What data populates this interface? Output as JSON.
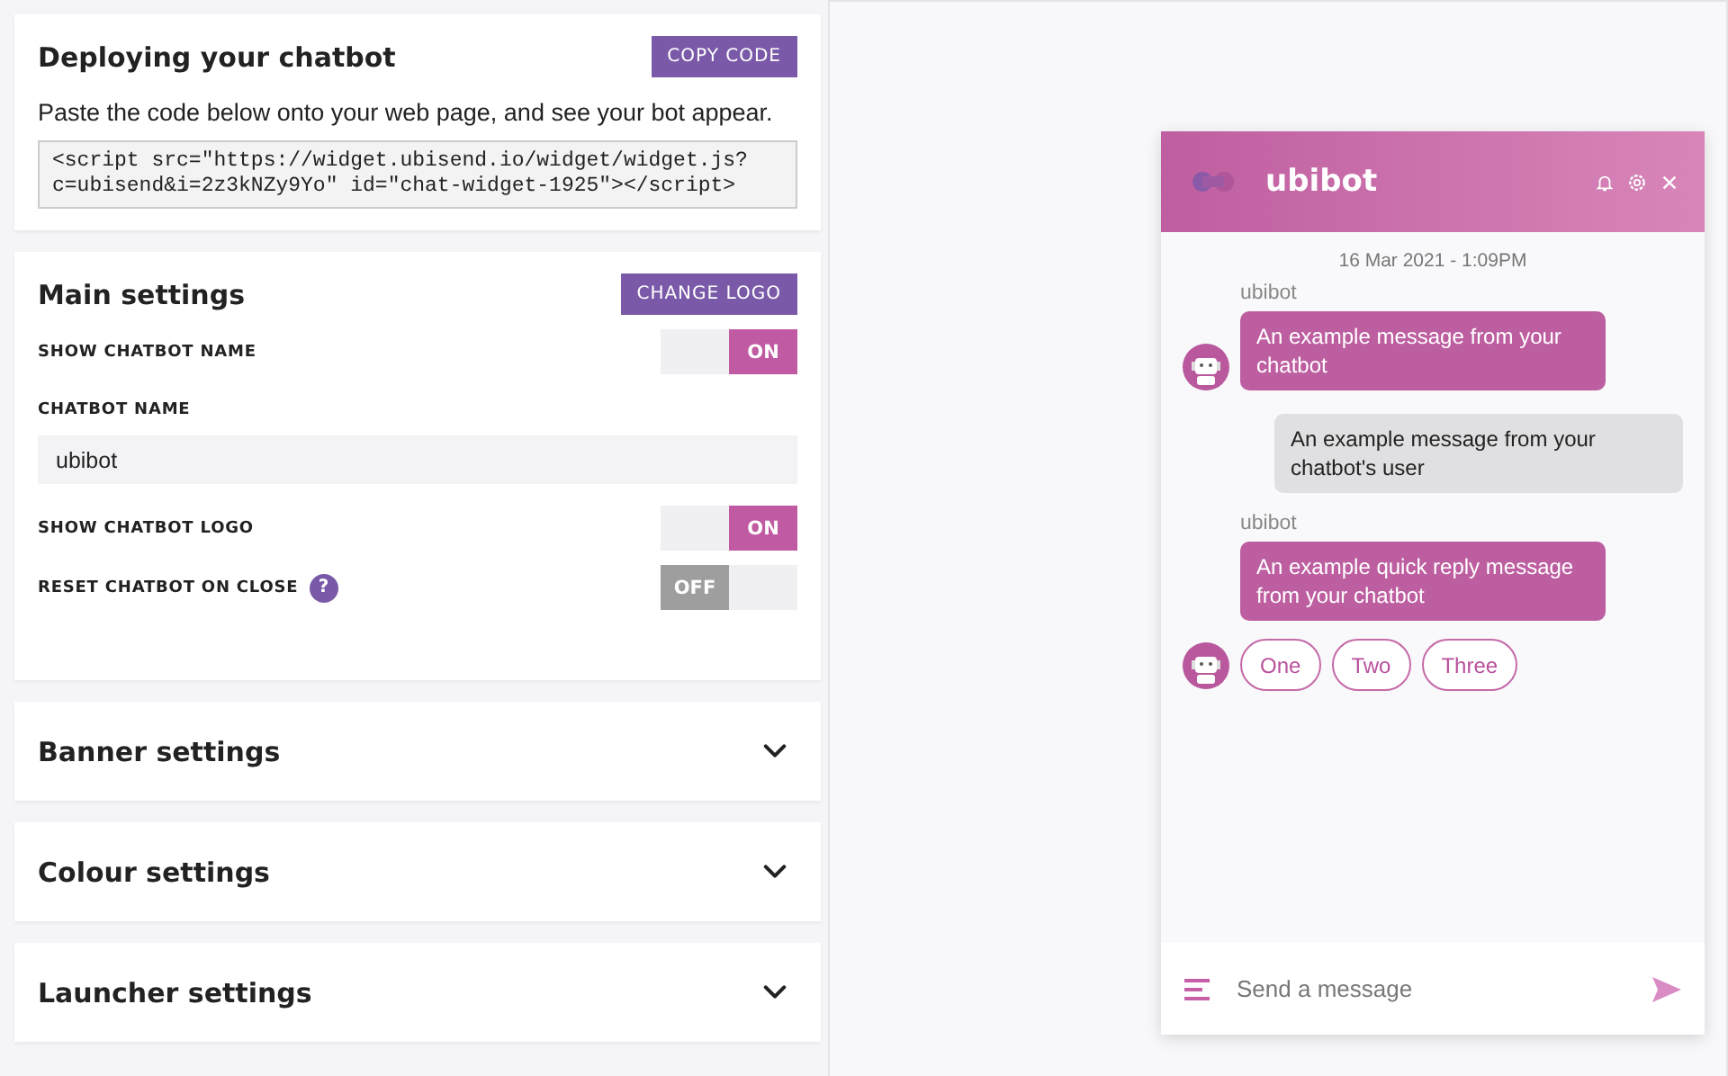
{
  "deploy": {
    "title": "Deploying your chatbot",
    "button": "COPY CODE",
    "description": "Paste the code below onto your web page, and see your bot appear.",
    "code": "<script src=\"https://widget.ubisend.io/widget/widget.js?\nc=ubisend&i=2z3kNZy9Yo\" id=\"chat-widget-1925\"></script>"
  },
  "main_settings": {
    "title": "Main settings",
    "button": "CHANGE LOGO",
    "rows": [
      {
        "kind": "toggle",
        "label": "SHOW CHATBOT NAME",
        "on": true,
        "state_label": "ON"
      },
      {
        "kind": "field",
        "label": "CHATBOT NAME",
        "value": "ubibot"
      },
      {
        "kind": "toggle",
        "label": "SHOW CHATBOT LOGO",
        "on": true,
        "state_label": "ON"
      },
      {
        "kind": "toggle",
        "label": "RESET CHATBOT ON CLOSE",
        "help": "?",
        "on": false,
        "state_label": "OFF"
      }
    ]
  },
  "sections": [
    {
      "title": "Banner settings",
      "expanded": false
    },
    {
      "title": "Colour settings",
      "expanded": false
    },
    {
      "title": "Launcher settings",
      "expanded": false
    }
  ],
  "chat": {
    "title": "ubibot",
    "timestamp": "16 Mar 2021 - 1:09PM",
    "messages": [
      {
        "kind": "bot",
        "sender": "ubibot",
        "text": "An example message from your chatbot",
        "avatar": true
      },
      {
        "kind": "user",
        "text": "An example message from your chatbot's user"
      },
      {
        "kind": "bot",
        "sender": "ubibot",
        "text": "An example quick reply message from your chatbot",
        "avatar": false
      },
      {
        "kind": "quick_replies",
        "avatar": true,
        "options": [
          "One",
          "Two",
          "Three"
        ]
      }
    ],
    "input": {
      "placeholder": "Send a message"
    }
  }
}
